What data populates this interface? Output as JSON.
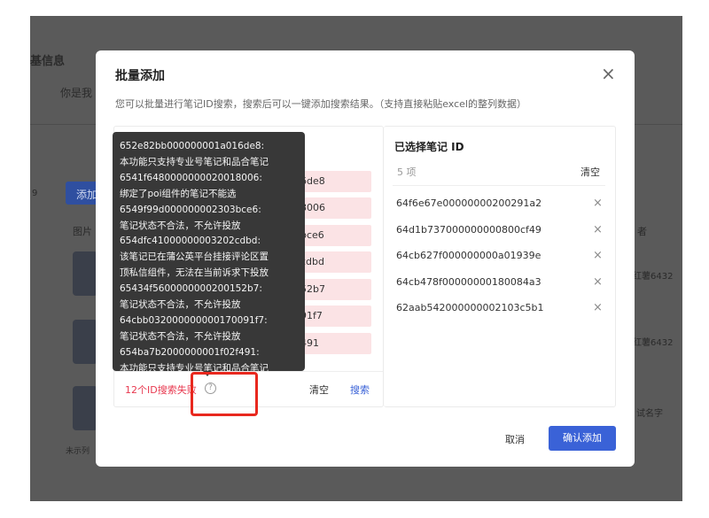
{
  "background": {
    "section_title": "基信息",
    "field_label": "你是我",
    "section_mark": "9",
    "add_button": "添加",
    "col_image": "图片",
    "col_author": "者",
    "row_texts": [
      "红薯6432",
      "红薯6432",
      "试名字"
    ],
    "footer_hint": "未示列"
  },
  "modal": {
    "title": "批量添加",
    "description": "您可以批量进行笔记ID搜索，搜索后可以一键添加搜索结果。（支持直接粘贴excel的整列数据）",
    "failed_items": [
      "6de8",
      "8006",
      "bce6",
      "cdbd",
      "52b7",
      "91f7",
      "491"
    ],
    "fail_text": "12个ID搜索失败",
    "clear_label": "清空",
    "search_label": "搜索",
    "selected_title": "已选择笔记 ID",
    "selected_count": "5 项",
    "selected_clear": "清空",
    "selected_ids": [
      "64f6e67e00000000200291a2",
      "64d1b737000000000800cf49",
      "64cb627f000000000a01939e",
      "64cb478f00000000180084a3",
      "62aab542000000002103c5b1"
    ],
    "remove_icon": "×",
    "cancel_label": "取消",
    "confirm_label": "确认添加"
  },
  "tooltip": {
    "lines": [
      "652e82bb000000001a016de8:",
      "本功能只支持专业号笔记和品合笔记",
      "6541f6480000000020018006:",
      "绑定了poi组件的笔记不能选",
      "6549f99d000000002303bce6:",
      "笔记状态不合法，不允许投放",
      "654dfc41000000003202cdbd:",
      "该笔记已在蒲公英平台挂接评论区置",
      "顶私信组件，无法在当前诉求下投放",
      "65434f5600000000200152b7:",
      "笔记状态不合法，不允许投放",
      "64cbb032000000000170091f7:",
      "笔记状态不合法，不允许投放",
      "654ba7b2000000001f02f491:",
      "本功能只支持专业号笔记和品合笔记"
    ]
  },
  "colors": {
    "primary": "#3a62d7",
    "error": "#e8384f",
    "highlight": "#e8281e",
    "tooltip_bg": "#383838"
  }
}
